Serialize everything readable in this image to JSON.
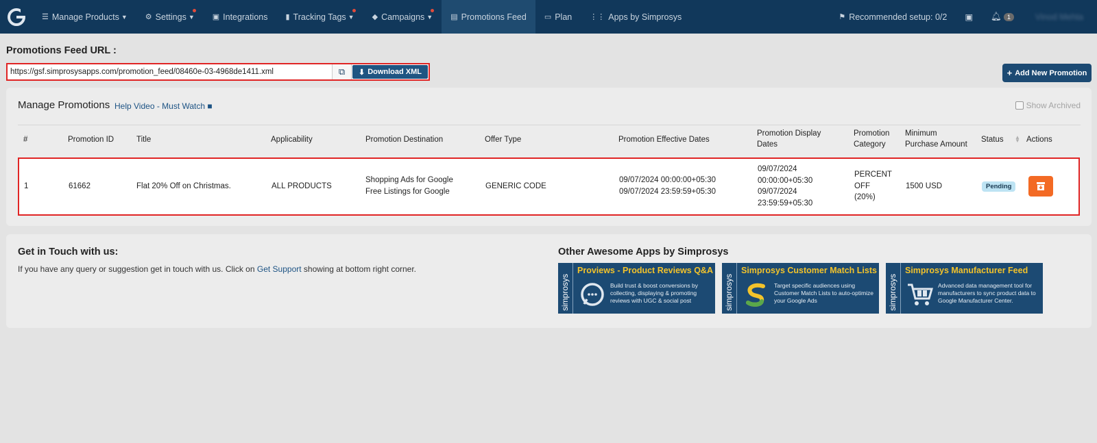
{
  "nav": {
    "logo": "G",
    "items": [
      {
        "label": "Manage Products",
        "icon": "list-icon",
        "caret": true,
        "dot": false
      },
      {
        "label": "Settings",
        "icon": "gear-icon",
        "caret": true,
        "dot": true
      },
      {
        "label": "Integrations",
        "icon": "briefcase-icon",
        "caret": false,
        "dot": false
      },
      {
        "label": "Tracking Tags",
        "icon": "bar-chart-icon",
        "caret": true,
        "dot": true
      },
      {
        "label": "Campaigns",
        "icon": "tag-icon",
        "caret": true,
        "dot": true
      },
      {
        "label": "Promotions Feed",
        "icon": "file-icon",
        "caret": false,
        "dot": false,
        "active": true
      },
      {
        "label": "Plan",
        "icon": "card-icon",
        "caret": false,
        "dot": false
      },
      {
        "label": "Apps by Simprosys",
        "icon": "grid-icon",
        "caret": false,
        "dot": false
      }
    ],
    "recommended_setup": "Recommended setup: 0/2",
    "notification_count": "1",
    "user_name": "Vinod Mehta"
  },
  "feed": {
    "label": "Promotions Feed URL :",
    "url": "https://gsf.simprosysapps.com/promotion_feed/08460e-03-4968de1411.xml",
    "download_label": "Download XML",
    "add_label": "Add New Promotion"
  },
  "manage": {
    "title": "Manage Promotions",
    "help_link": "Help Video - Must Watch",
    "show_archived": "Show Archived",
    "columns": {
      "num": "#",
      "id": "Promotion ID",
      "title": "Title",
      "applicability": "Applicability",
      "destination": "Promotion Destination",
      "offer": "Offer Type",
      "effective": "Promotion Effective Dates",
      "display_1": "Promotion Display",
      "display_2": "Dates",
      "category_1": "Promotion",
      "category_2": "Category",
      "min_1": "Minimum",
      "min_2": "Purchase Amount",
      "status": "Status",
      "actions": "Actions"
    },
    "rows": [
      {
        "num": "1",
        "id": "61662",
        "title": "Flat 20% Off on Christmas.",
        "applicability": "ALL PRODUCTS",
        "destination_1": "Shopping Ads for Google",
        "destination_2": "Free Listings for Google",
        "offer": "GENERIC CODE",
        "effective_1": "09/07/2024 00:00:00+05:30",
        "effective_2": "09/07/2024 23:59:59+05:30",
        "display_1": "09/07/2024",
        "display_2": "00:00:00+05:30",
        "display_3": "09/07/2024",
        "display_4": "23:59:59+05:30",
        "category_1": "PERCENT",
        "category_2": "OFF",
        "category_3": "(20%)",
        "min_amount": "1500 USD",
        "status": "Pending"
      }
    ]
  },
  "contact": {
    "title": "Get in Touch with us:",
    "text_before": "If you have any query or suggestion get in touch with us. Click on ",
    "link": "Get Support",
    "text_after": " showing at bottom right corner."
  },
  "apps": {
    "title": "Other Awesome Apps by Simprosys",
    "brand": "simprosys",
    "items": [
      {
        "name": "Proviews - Product Reviews Q&A",
        "desc": "Build trust & boost conversions by collecting, displaying & promoting reviews with UGC & social post",
        "icon": "chat-bubble-icon"
      },
      {
        "name": "Simprosys Customer Match Lists",
        "desc": "Target specific audiences using Customer Match Lists to auto-optimize your Google Ads",
        "icon": "s-logo-icon"
      },
      {
        "name": "Simprosys Manufacturer Feed",
        "desc": "Advanced data management tool for manufacturers to sync product data to Google Manufacturer Center.",
        "icon": "cart-icon"
      }
    ]
  },
  "colors": {
    "navbar": "#11385b",
    "accent": "#1f5582",
    "highlight_border": "#e02424",
    "action": "#f36a24",
    "app_title": "#f3c32b"
  }
}
